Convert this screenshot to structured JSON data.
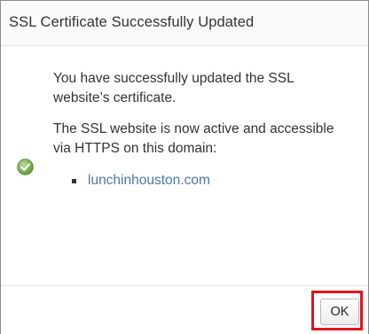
{
  "dialog": {
    "title": "SSL Certificate Successfully Updated",
    "message_1": "You have successfully updated the SSL website’s certificate.",
    "message_2": "The SSL website is now active and accessible via HTTPS on this domain:",
    "domains": [
      "lunchinhouston.com"
    ],
    "status_icon": "check-circle-icon",
    "ok_label": "OK"
  },
  "colors": {
    "link": "#4f77a8",
    "highlight": "#e0141c",
    "success": "#6aa842"
  }
}
